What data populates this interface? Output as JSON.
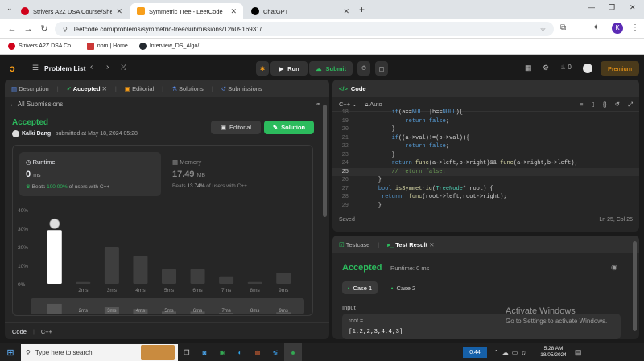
{
  "browser": {
    "tabs": [
      {
        "title": "Strivers A2Z DSA Course/Sheet",
        "favicon_color": "#d0021b"
      },
      {
        "title": "Symmetric Tree - LeetCode",
        "favicon_color": "#f89f1b"
      },
      {
        "title": "ChatGPT",
        "favicon_color": "#000000"
      }
    ],
    "url": "leetcode.com/problems/symmetric-tree/submissions/1260916931/",
    "bookmarks": [
      "Strivers A2Z DSA Co...",
      "npm | Home",
      "Interview_DS_Algo/..."
    ],
    "profile_initial": "K"
  },
  "nav": {
    "problem_list": "Problem List",
    "run": "Run",
    "submit": "Submit",
    "streak": "0",
    "premium": "Premium"
  },
  "left_tabs": [
    "Description",
    "Accepted",
    "Editorial",
    "Solutions",
    "Submissions"
  ],
  "submission": {
    "back": "All Submissions",
    "status": "Accepted",
    "user": "Kalki Dang",
    "submitted_text": "submitted at May 18, 2024 05:28",
    "editorial_btn": "Editorial",
    "solution_btn": "Solution",
    "runtime_label": "Runtime",
    "runtime_value": "0",
    "runtime_unit": "ms",
    "runtime_beats_prefix": "Beats",
    "runtime_beats": "100.00%",
    "runtime_beats_suffix": "of users with C++",
    "memory_label": "Memory",
    "memory_value": "17.49",
    "memory_unit": "MB",
    "memory_beats_prefix": "Beats",
    "memory_beats": "13.74%",
    "memory_beats_suffix": "of users with C++",
    "footer_code": "Code",
    "footer_lang": "C++"
  },
  "chart_data": {
    "type": "bar",
    "categories": [
      "0ms",
      "2ms",
      "3ms",
      "4ms",
      "5ms",
      "6ms",
      "7ms",
      "8ms",
      "9ms"
    ],
    "values": [
      29,
      1,
      20,
      15,
      8,
      8,
      4,
      1,
      6
    ],
    "shown_labels": [
      "",
      "2ms",
      "3ms",
      "4ms",
      "5ms",
      "6ms",
      "7ms",
      "8ms",
      "9ms"
    ],
    "yticks": [
      "40%",
      "30%",
      "20%",
      "10%",
      "0%"
    ],
    "ylim": [
      0,
      40
    ],
    "highlight_index": 0,
    "highlight_color": "#ffffff",
    "bar_color": "#3e3e3e"
  },
  "editor": {
    "title": "Code",
    "lang": "C++",
    "mode": "Auto",
    "saved": "Saved",
    "cursor": "Ln 25, Col 25",
    "lines": [
      {
        "n": "18",
        "t": "        if(a==NULL||b==NULL){"
      },
      {
        "n": "19",
        "t": "            return false;"
      },
      {
        "n": "20",
        "t": "        }"
      },
      {
        "n": "21",
        "t": "        if((a->val)!=(b->val)){"
      },
      {
        "n": "22",
        "t": "            return false;"
      },
      {
        "n": "23",
        "t": "        }"
      },
      {
        "n": "24",
        "t": "        return func(a->left,b->right)&& func(a->right,b->left);"
      },
      {
        "n": "25",
        "t": "        // return false;"
      },
      {
        "n": "26",
        "t": "    }"
      },
      {
        "n": "27",
        "t": "    bool isSymmetric(TreeNode* root) {"
      },
      {
        "n": "28",
        "t": "     return  func(root->left,root->right);"
      },
      {
        "n": "29",
        "t": "    }"
      }
    ]
  },
  "result": {
    "tab_testcase": "Testcase",
    "tab_result": "Test Result",
    "status": "Accepted",
    "runtime": "Runtime: 0 ms",
    "case1": "Case 1",
    "case2": "Case 2",
    "input_label": "Input",
    "var": "root =",
    "value": "[1,2,2,3,4,4,3]"
  },
  "watermark": {
    "line1": "Activate Windows",
    "line2": "Go to Settings to activate Windows."
  },
  "taskbar": {
    "search": "Type here to search",
    "weather": "0:44",
    "time": "5:28 AM",
    "date": "18/05/2024"
  }
}
